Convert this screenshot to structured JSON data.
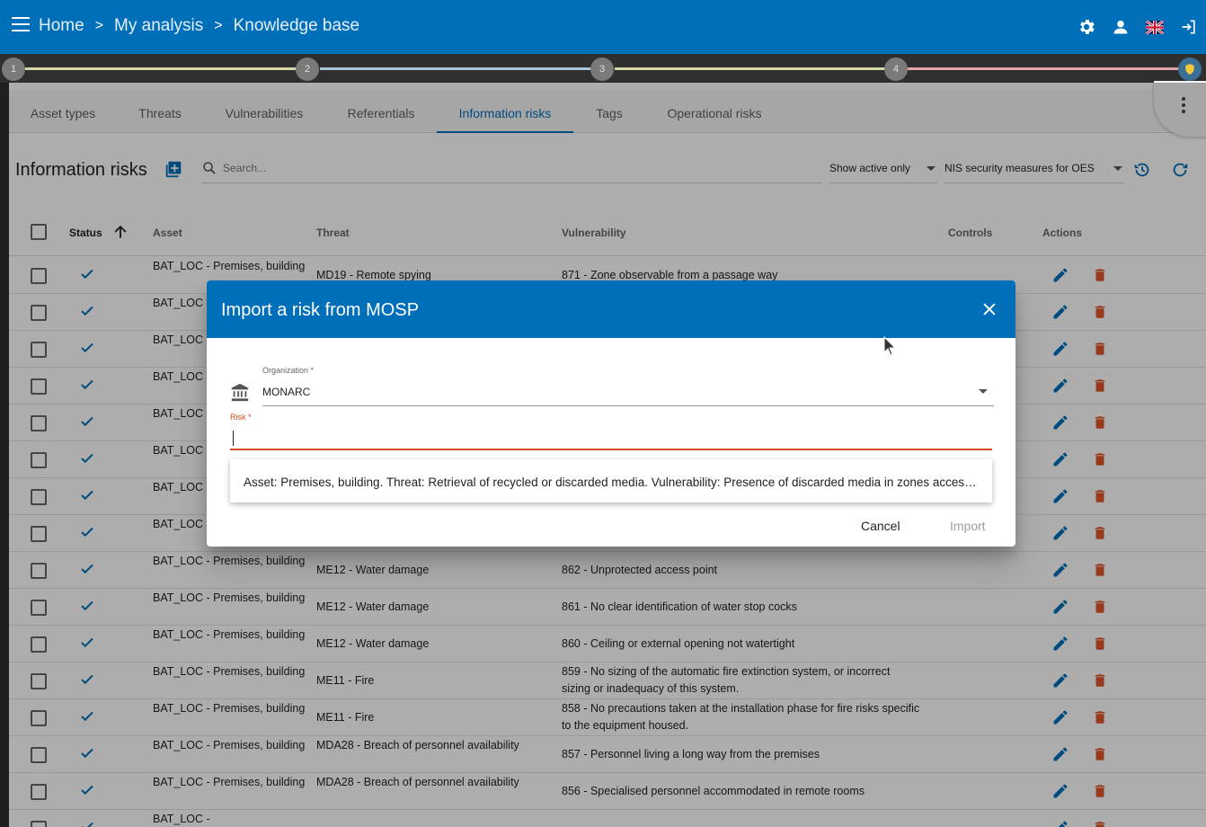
{
  "topbar": {
    "breadcrumbs": [
      "Home",
      "My analysis",
      "Knowledge base"
    ],
    "separator": ">",
    "icons": [
      "settings-icon",
      "user-icon",
      "uk-flag-icon",
      "logout-icon"
    ]
  },
  "stepper": {
    "steps": [
      "1",
      "2",
      "3",
      "4"
    ]
  },
  "tabs": [
    "Asset types",
    "Threats",
    "Vulnerabilities",
    "Referentials",
    "Information risks",
    "Tags",
    "Operational risks"
  ],
  "active_tab": "Information risks",
  "toolbar": {
    "title": "Information risks",
    "search_placeholder": "Search...",
    "filter_status": "Show active only",
    "filter_referential": "NIS security measures for OES"
  },
  "table": {
    "headers": {
      "status": "Status",
      "asset": "Asset",
      "threat": "Threat",
      "vulnerability": "Vulnerability",
      "controls": "Controls",
      "actions": "Actions"
    },
    "rows": [
      {
        "asset": "BAT_LOC - Premises, building",
        "threat": "MD19 - Remote spying",
        "vuln": "871 - Zone observable from a passage way"
      },
      {
        "asset": "BAT_LOC - Premises, building",
        "threat": "",
        "vuln": ""
      },
      {
        "asset": "BAT_LOC - Premises, building",
        "threat": "",
        "vuln": ""
      },
      {
        "asset": "BAT_LOC - Premises, building",
        "threat": "",
        "vuln": ""
      },
      {
        "asset": "BAT_LOC - Premises, building",
        "threat": "",
        "vuln": ""
      },
      {
        "asset": "BAT_LOC - Premises, building",
        "threat": "",
        "vuln": ""
      },
      {
        "asset": "BAT_LOC - Premises, building",
        "threat": "",
        "vuln": ""
      },
      {
        "asset": "BAT_LOC - Premises, building",
        "threat": "",
        "vuln": ""
      },
      {
        "asset": "BAT_LOC - Premises, building",
        "threat": "ME12 - Water damage",
        "vuln": "862 - Unprotected access point"
      },
      {
        "asset": "BAT_LOC - Premises, building",
        "threat": "ME12 - Water damage",
        "vuln": "861 - No clear identification of water stop cocks"
      },
      {
        "asset": "BAT_LOC - Premises, building",
        "threat": "ME12 - Water damage",
        "vuln": "860 - Ceiling or external opening not watertight"
      },
      {
        "asset": "BAT_LOC - Premises, building",
        "threat": "ME11 - Fire",
        "vuln": "859 - No sizing of the automatic fire extinction system, or incorrect sizing or inadequacy of this system."
      },
      {
        "asset": "BAT_LOC - Premises, building",
        "threat": "ME11 - Fire",
        "vuln": "858 - No precautions taken at the installation phase for fire risks specific to the equipment housed."
      },
      {
        "asset": "BAT_LOC - Premises, building",
        "threat": "MDA28 - Breach of personnel availability",
        "vuln": "857 - Personnel living a long way from the premises"
      },
      {
        "asset": "BAT_LOC - Premises, building",
        "threat": "MDA28 - Breach of personnel availability",
        "vuln": "856 - Specialised personnel accommodated in remote rooms"
      },
      {
        "asset": "BAT_LOC -",
        "threat": "",
        "vuln": ""
      }
    ]
  },
  "dialog": {
    "title": "Import a risk from MOSP",
    "organization_label": "Organization *",
    "organization_value": "MONARC",
    "risk_label": "Risk *",
    "risk_value": "",
    "option": "Asset: Premises, building. Threat: Retrieval of recycled or discarded media. Vulnerability: Presence of discarded media in zones accessible to the public",
    "cancel_label": "Cancel",
    "import_label": "Import"
  },
  "colors": {
    "primary": "#006fba",
    "error": "#d24a19",
    "delete": "#e0532a",
    "check": "#006fba"
  }
}
